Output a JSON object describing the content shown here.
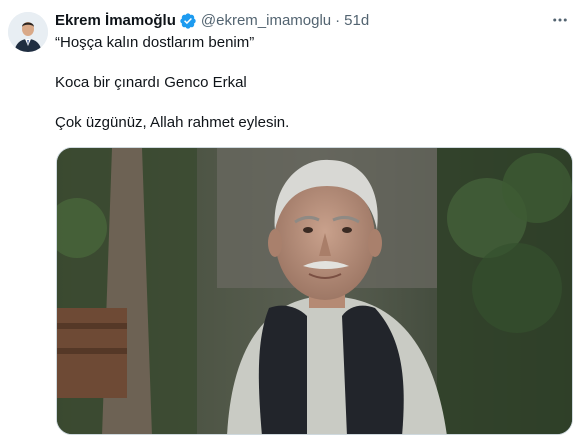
{
  "tweet": {
    "author": {
      "display_name": "Ekrem İmamoğlu",
      "handle": "@ekrem_imamoglu",
      "verified": true,
      "avatar_icon": "profile-avatar"
    },
    "separator": "·",
    "time": "51d",
    "lines": [
      "“Hoşça kalın dostlarım benim”",
      "Koca bir çınardı Genco Erkal",
      "Çok üzgünüz, Allah rahmet eylesin."
    ],
    "media": {
      "type": "photo",
      "icon": "photo-portrait"
    },
    "more_icon": "more-horizontal-icon"
  },
  "colors": {
    "text_primary": "#0f1419",
    "text_secondary": "#536471",
    "verified_blue": "#1d9bf0",
    "border": "#cfd9de"
  }
}
